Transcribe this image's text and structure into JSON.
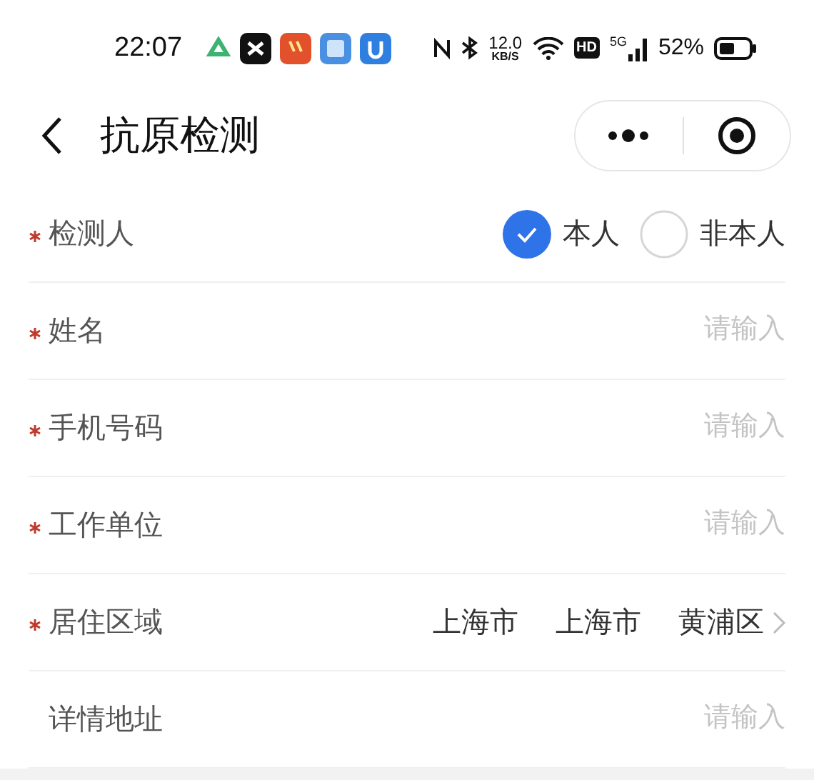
{
  "status_bar": {
    "time": "22:07",
    "speed_value": "12.0",
    "speed_unit": "KB/S",
    "hd": "HD",
    "network": "5G",
    "battery": "52%"
  },
  "header": {
    "title": "抗原检测"
  },
  "fields": [
    {
      "kind": "choice",
      "label": "检测人",
      "required": true,
      "options": [
        {
          "label": "本人",
          "selected": true
        },
        {
          "label": "非本人",
          "selected": false
        }
      ]
    },
    {
      "kind": "input",
      "label": "姓名",
      "required": true,
      "placeholder": "请输入"
    },
    {
      "kind": "input",
      "label": "手机号码",
      "required": true,
      "placeholder": "请输入"
    },
    {
      "kind": "input",
      "label": "工作单位",
      "required": true,
      "placeholder": "请输入"
    },
    {
      "kind": "region",
      "label": "居住区域",
      "required": true,
      "values": [
        "上海市",
        "上海市",
        "黄浦区"
      ]
    },
    {
      "kind": "input",
      "label": "详情地址",
      "required": false,
      "placeholder": "请输入"
    }
  ]
}
